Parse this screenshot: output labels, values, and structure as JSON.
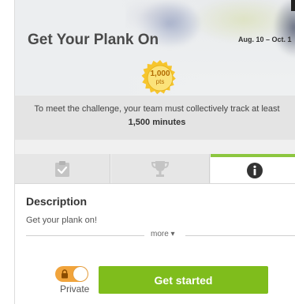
{
  "challenge": {
    "title": "Get Your Plank On",
    "dates": "Aug. 10 – Oct. 1",
    "points": {
      "value": "1,000",
      "unit": "pts"
    },
    "goal_text": "To meet the challenge, your team must collectively track at least",
    "goal_value": "1,500 minutes"
  },
  "tabs": [
    {
      "icon": "checklist-icon",
      "active": false
    },
    {
      "icon": "trophy-icon",
      "active": false
    },
    {
      "icon": "info-icon",
      "active": true
    }
  ],
  "description": {
    "heading": "Description",
    "text": "Get your plank on!",
    "more_label": "more ▾"
  },
  "privacy": {
    "label": "Private",
    "enabled": true
  },
  "actions": {
    "start_label": "Get started"
  },
  "colors": {
    "accent_green": "#8cc63f",
    "button_green": "#7fbd1c",
    "toggle_orange": "#f1a43c",
    "badge_gold": "#f7d34a"
  }
}
